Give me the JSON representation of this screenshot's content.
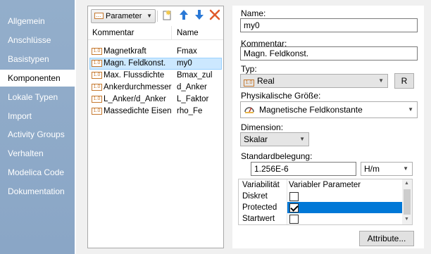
{
  "sidebar": {
    "items": [
      {
        "label": "Allgemein"
      },
      {
        "label": "Anschlüsse"
      },
      {
        "label": "Basistypen"
      },
      {
        "label": "Komponenten",
        "active": true
      },
      {
        "label": "Lokale Typen"
      },
      {
        "label": "Import"
      },
      {
        "label": "Activity Groups"
      },
      {
        "label": "Verhalten"
      },
      {
        "label": "Modelica Code"
      },
      {
        "label": "Dokumentation"
      }
    ]
  },
  "toolbar": {
    "dropdown_label": "Parameter",
    "icons": [
      "new-item-icon",
      "move-up-icon",
      "move-down-icon",
      "delete-icon"
    ]
  },
  "param_list": {
    "columns": [
      "Kommentar",
      "Name"
    ],
    "type_badge": "1.0",
    "rows": [
      {
        "kommentar": "Magnetkraft",
        "name": "Fmax"
      },
      {
        "kommentar": "Magn. Feldkonst.",
        "name": "my0",
        "selected": true
      },
      {
        "kommentar": "Max. Flussdichte",
        "name": "Bmax_zul"
      },
      {
        "kommentar": "Ankerdurchmesser",
        "name": "d_Anker"
      },
      {
        "kommentar": "L_Anker/d_Anker",
        "name": "L_Faktor"
      },
      {
        "kommentar": "Massedichte Eisen",
        "name": "rho_Fe"
      }
    ]
  },
  "props": {
    "name_label": "Name:",
    "name_value": "my0",
    "kommentar_label": "Kommentar:",
    "kommentar_value": "Magn. Feldkonst.",
    "typ_label": "Typ:",
    "typ_value": "Real",
    "typ_button": "R",
    "physik_label": "Physikalische Größe:",
    "physik_value": "Magnetische Feldkonstante",
    "dimension_label": "Dimension:",
    "dimension_value": "Skalar",
    "standard_label": "Standardbelegung:",
    "standard_value": "1.256E-6",
    "unit_value": "H/m",
    "grid": {
      "headers": [
        "Variabilität",
        "Variabler Parameter"
      ],
      "rows": [
        {
          "label": "Diskret",
          "checked": false
        },
        {
          "label": "Protected",
          "checked": true
        },
        {
          "label": "Startwert",
          "checked": false
        }
      ]
    },
    "attribute_button": "Attribute..."
  },
  "colors": {
    "sidebar_bg": "#8aa6c6",
    "selection_bg": "#cce8ff",
    "grid_highlight": "#0078d7",
    "up_arrow": "#2b79d6",
    "down_arrow": "#2b79d6",
    "delete": "#e05a2a"
  }
}
